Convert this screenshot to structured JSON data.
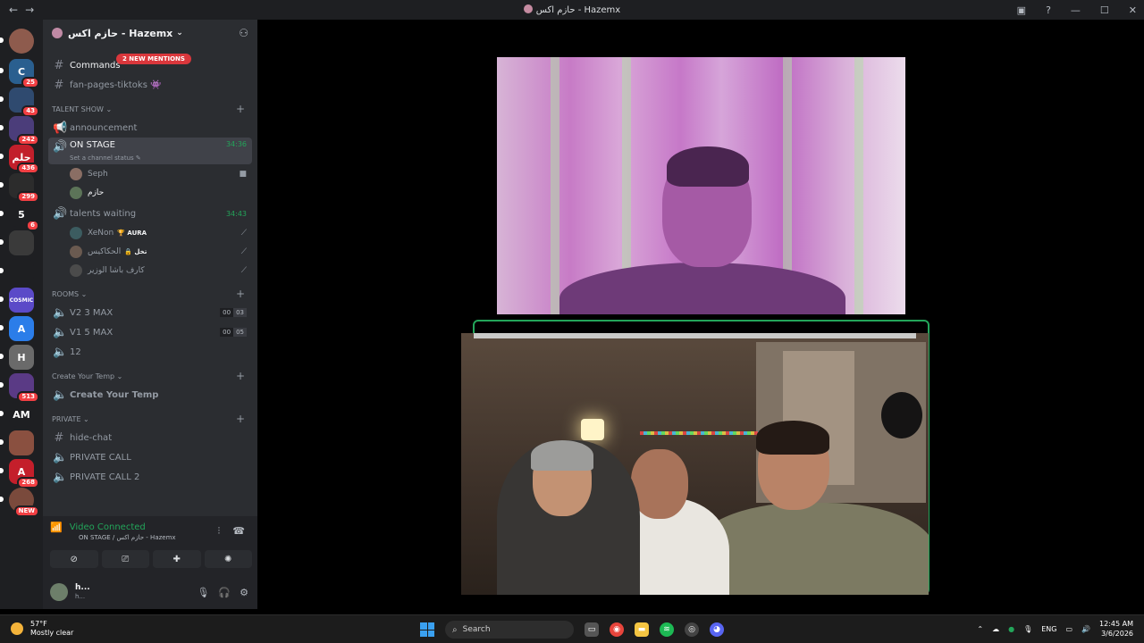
{
  "window": {
    "title": "حازم اكس - Hazemx",
    "back": "←",
    "forward": "→",
    "min": "—",
    "max": "☐",
    "close": "✕"
  },
  "guilds": [
    {
      "badge": "",
      "color": "#8e5b4d",
      "label": ""
    },
    {
      "badge": "25",
      "color": "#2a5f8f",
      "label": "C"
    },
    {
      "badge": "43",
      "color": "#2f4a6f",
      "label": ""
    },
    {
      "badge": "242",
      "color": "#4b3d7a",
      "label": ""
    },
    {
      "badge": "436",
      "color": "#c21f2b",
      "label": "حلم"
    },
    {
      "badge": "299",
      "color": "#2c2c2c",
      "label": ""
    },
    {
      "badge": "6",
      "color": "#1e1f22",
      "label": "5"
    },
    {
      "badge": "",
      "color": "#3a3a3a",
      "label": ""
    },
    {
      "badge": "",
      "color": "#1e1f22",
      "label": ""
    },
    {
      "badge": "",
      "color": "#5b4ac8",
      "label": "COSMIC"
    },
    {
      "badge": "",
      "color": "#2b7de9",
      "label": "A"
    },
    {
      "badge": "",
      "color": "#6a6a6a",
      "label": "H"
    },
    {
      "badge": "513",
      "color": "#5a3a85",
      "label": ""
    },
    {
      "badge": "",
      "color": "#1e1f22",
      "label": "AM"
    },
    {
      "badge": "",
      "color": "#8a5040",
      "label": ""
    },
    {
      "badge": "268",
      "color": "#c41f2b",
      "label": "A"
    },
    {
      "badge": "NEW",
      "color": "#7a4a3c",
      "label": ""
    }
  ],
  "server": {
    "name": "حازم اكس - Hazemx",
    "mentions": "2 NEW MENTIONS"
  },
  "channels": {
    "commands": "Commands",
    "fanpages": "fan-pages-tiktoks 👾",
    "cat_talent": "TALENT SHOW",
    "announcement": "announcement",
    "on_stage": "ON STAGE",
    "on_stage_time": "34:36",
    "on_stage_status": "Set a channel status ✎",
    "user_seph": "Seph",
    "user_hazem": "حازم",
    "talents_waiting": "talents waiting",
    "talents_time": "34:43",
    "user_xenon": "XeNon",
    "user_xenon_tag": "🏆 AURA",
    "user_2": "الحكاكيس",
    "user_2_tag": "🔒 تخل",
    "user_3": "كارف باشا الوزير",
    "cat_rooms": "ROOMS",
    "v2": "V2 3 MAX",
    "v2_a": "00",
    "v2_b": "03",
    "v1": "V1 5 MAX",
    "v1_a": "00",
    "v1_b": "05",
    "r12": "12",
    "cat_temp": "Create Your Temp",
    "create_temp": "Create Your Temp",
    "cat_private": "PRIVATE",
    "hide_chat": "hide-chat",
    "private_call": "PRIVATE CALL",
    "private_call2": "PRIVATE CALL 2"
  },
  "voice": {
    "status": "Video Connected",
    "location": "ON STAGE / حازم اكس - Hazemx"
  },
  "me": {
    "name": "h...",
    "sub": "h..."
  },
  "taskbar": {
    "temp": "57°F",
    "weather": "Mostly clear",
    "search": "Search",
    "lang": "ENG",
    "time": "12:45 AM",
    "date": "3/6/2026"
  }
}
